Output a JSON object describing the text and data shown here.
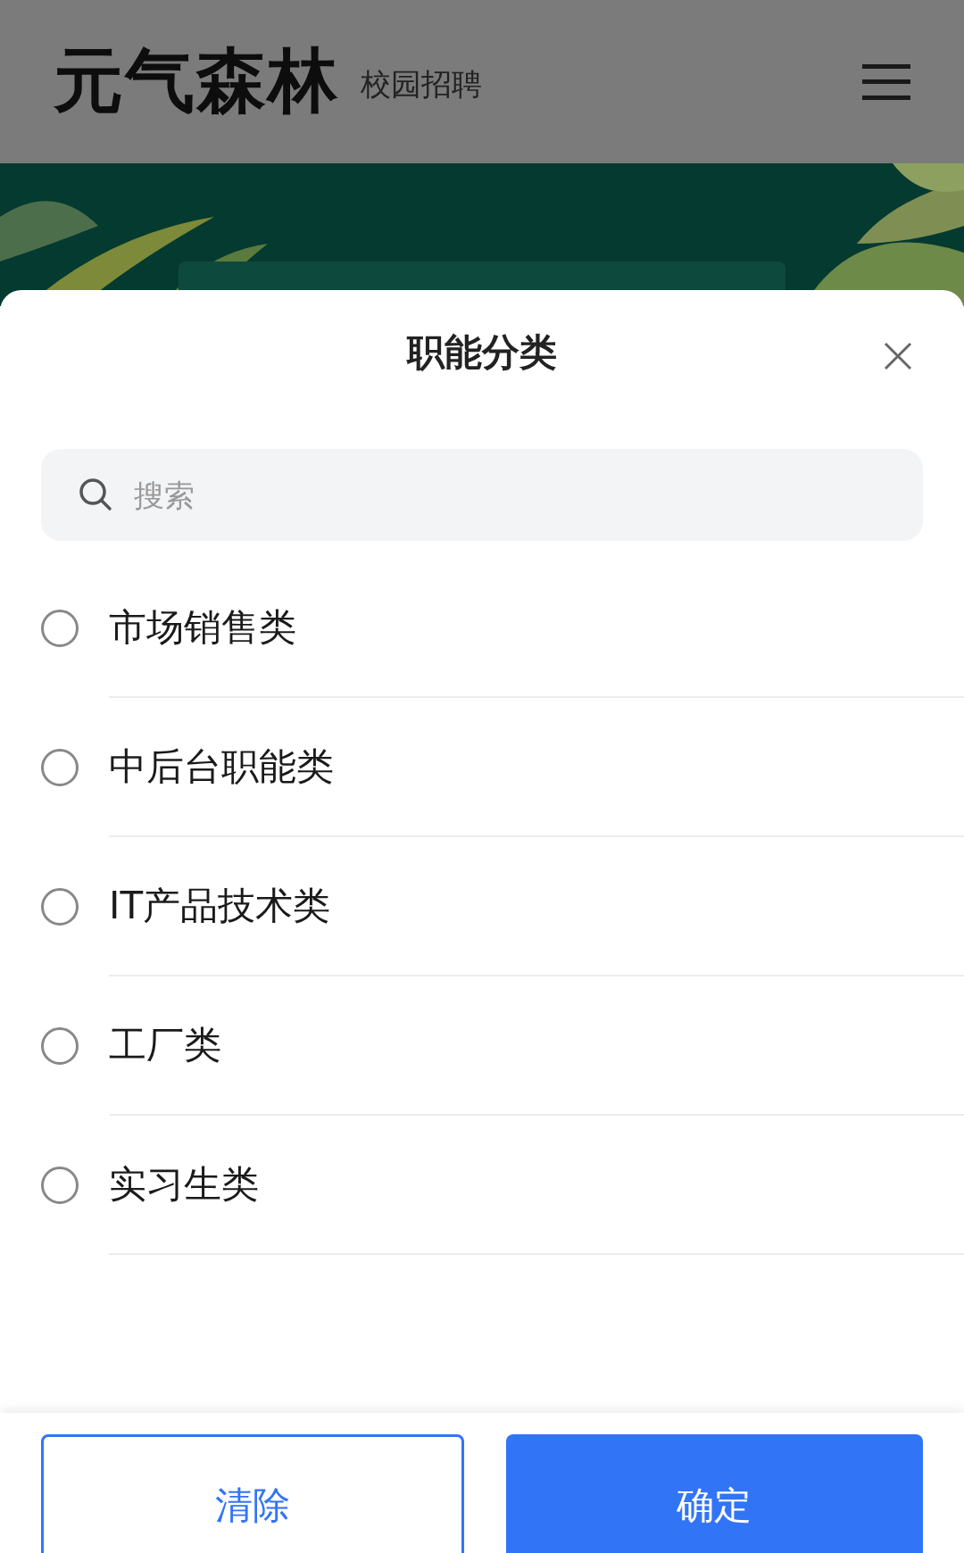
{
  "header": {
    "logo": "元气森林",
    "subtitle": "校园招聘"
  },
  "sheet": {
    "title": "职能分类",
    "search": {
      "placeholder": "搜索"
    },
    "options": [
      {
        "label": "市场销售类",
        "selected": false
      },
      {
        "label": "中后台职能类",
        "selected": false
      },
      {
        "label": "IT产品技术类",
        "selected": false
      },
      {
        "label": "工厂类",
        "selected": false
      },
      {
        "label": "实习生类",
        "selected": false
      }
    ],
    "buttons": [
      {
        "label": "清除",
        "kind": "secondary"
      },
      {
        "label": "确定",
        "kind": "primary"
      }
    ]
  }
}
